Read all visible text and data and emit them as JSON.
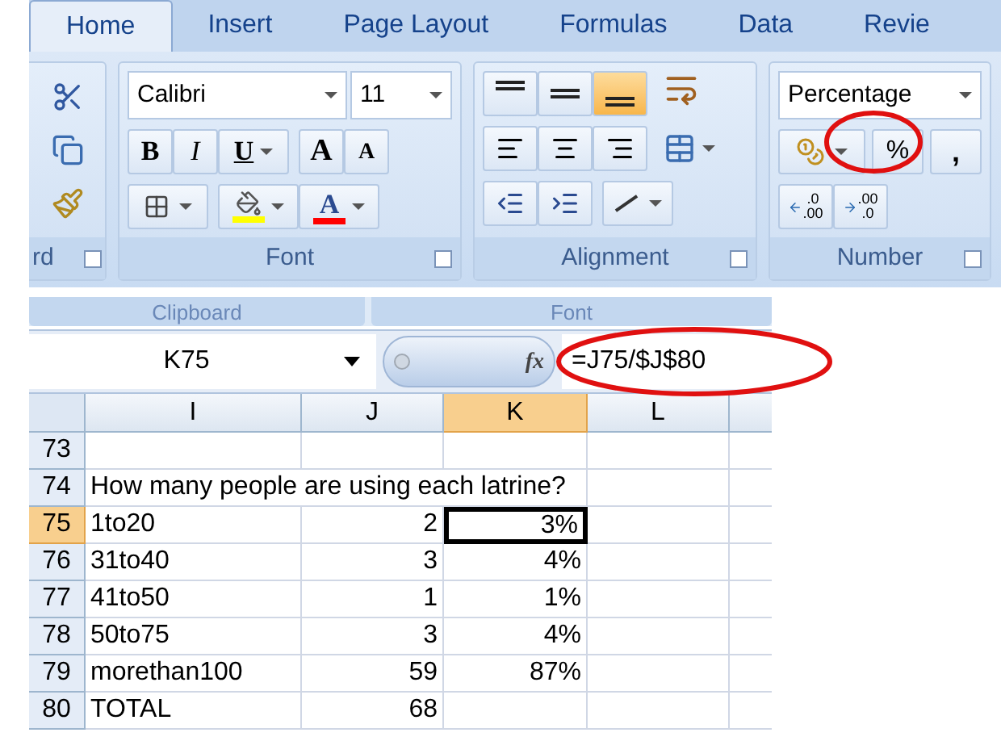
{
  "ribbon": {
    "tabs": [
      {
        "label": "Home",
        "selected": true
      },
      {
        "label": "Insert",
        "selected": false
      },
      {
        "label": "Page Layout",
        "selected": false
      },
      {
        "label": "Formulas",
        "selected": false
      },
      {
        "label": "Data",
        "selected": false
      },
      {
        "label": "Revie",
        "selected": false
      }
    ],
    "groups": [
      {
        "kind": "clipboard",
        "label": "rd"
      },
      {
        "kind": "font",
        "label": "Font",
        "font_name": "Calibri",
        "font_size": "11",
        "bold": "B",
        "italic": "I",
        "underline": "U",
        "grow": "A",
        "shrink": "A",
        "font_color": "A"
      },
      {
        "kind": "alignment",
        "label": "Alignment",
        "vertical_align": [
          {
            "selected": false
          },
          {
            "selected": false
          },
          {
            "selected": true
          }
        ]
      },
      {
        "kind": "number",
        "label": "Number",
        "format": "Percentage",
        "percent": "%",
        "comma": ",",
        "increase_decimal": [
          ".0",
          ".00"
        ],
        "decrease_decimal": [
          ".00",
          ".0"
        ]
      }
    ]
  },
  "lower_ribbon_strip": [
    "Clipboard",
    "Font"
  ],
  "sheet": {
    "name_box": "K75",
    "function_symbol": "fx",
    "formula": "=J75/$J$80",
    "columns": [
      {
        "label": "I",
        "selected": false
      },
      {
        "label": "J",
        "selected": false
      },
      {
        "label": "K",
        "selected": true
      },
      {
        "label": "L",
        "selected": false
      }
    ],
    "rows": [
      {
        "header": "73",
        "selected": false
      },
      {
        "header": "74",
        "selected": false,
        "label": "How many people are using each latrine?"
      },
      {
        "header": "75",
        "selected": true,
        "label": "1to20",
        "count": "2",
        "percent": "3%"
      },
      {
        "header": "76",
        "selected": false,
        "label": "31to40",
        "count": "3",
        "percent": "4%"
      },
      {
        "header": "77",
        "selected": false,
        "label": "41to50",
        "count": "1",
        "percent": "1%"
      },
      {
        "header": "78",
        "selected": false,
        "label": "50to75",
        "count": "3",
        "percent": "4%"
      },
      {
        "header": "79",
        "selected": false,
        "label": "morethan100",
        "count": "59",
        "percent": "87%"
      },
      {
        "header": "80",
        "selected": false,
        "label": "TOTAL",
        "count": "68"
      }
    ]
  }
}
